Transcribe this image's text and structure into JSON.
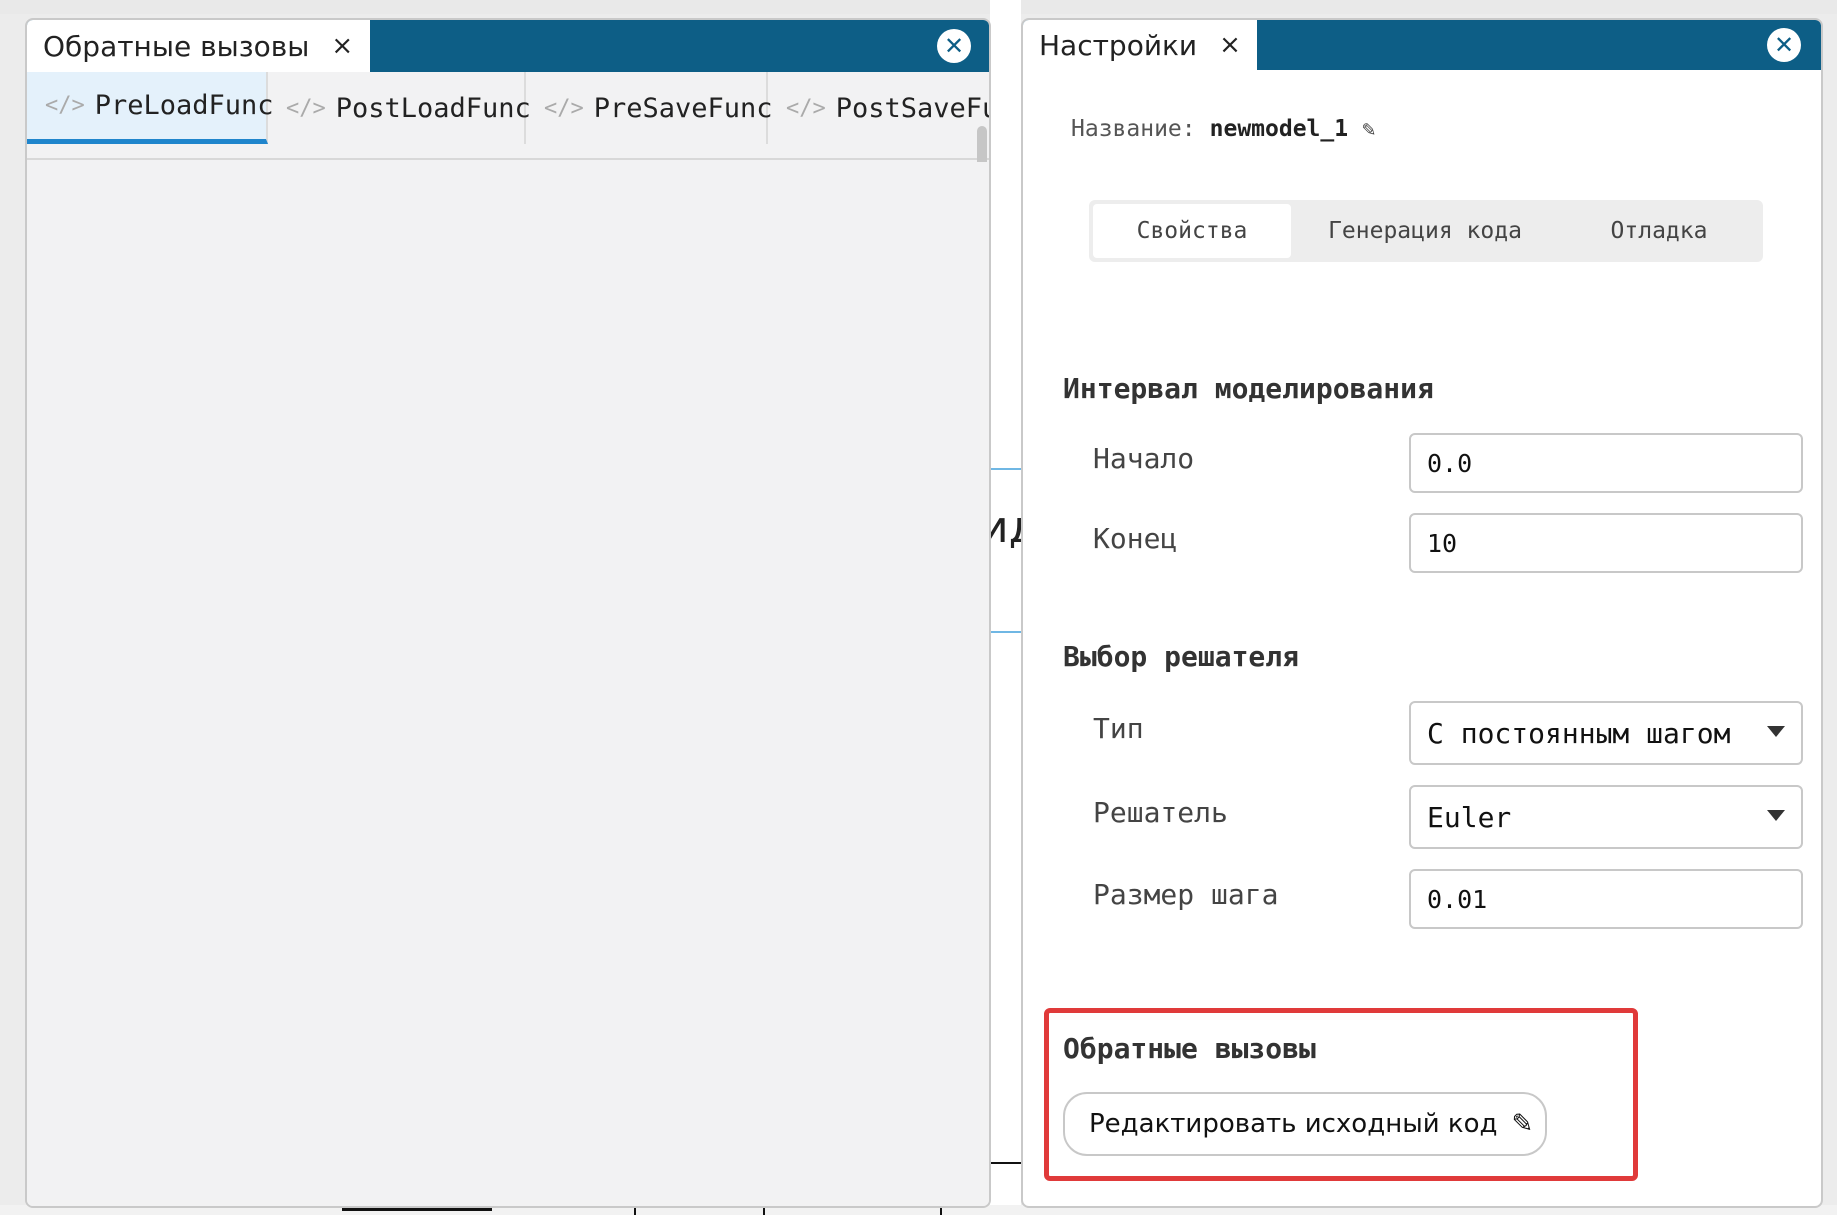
{
  "callbacks_panel": {
    "title": "Обратные вызовы",
    "tab_close": "×",
    "window_close": "✕",
    "tabs": [
      {
        "icon": "</>",
        "label": "PreLoadFunc",
        "active": true
      },
      {
        "icon": "</>",
        "label": "PostLoadFunc",
        "active": false
      },
      {
        "icon": "</>",
        "label": "PreSaveFunc",
        "active": false
      },
      {
        "icon": "</>",
        "label": "PostSaveFu",
        "active": false
      }
    ]
  },
  "background_canvas": {
    "partial_text": "ид"
  },
  "settings_panel": {
    "title": "Настройки",
    "tab_close": "×",
    "window_close": "✕",
    "name_label": "Название:",
    "name_value": "newmodel_1",
    "name_edit_icon": "✎",
    "segments": [
      {
        "label": "Свойства",
        "active": true
      },
      {
        "label": "Генерация кода",
        "active": false
      },
      {
        "label": "Отладка",
        "active": false
      }
    ],
    "interval": {
      "title": "Интервал моделирования",
      "start_label": "Начало",
      "start_value": "0.0",
      "end_label": "Конец",
      "end_value": "10"
    },
    "solver": {
      "title": "Выбор решателя",
      "type_label": "Тип",
      "type_value": "С постоянным шагом",
      "solver_label": "Решатель",
      "solver_value": "Euler",
      "step_label": "Размер шага",
      "step_value": "0.01"
    },
    "callbacks": {
      "title": "Обратные вызовы",
      "edit_button_label": "Редактировать исходный код",
      "edit_icon": "✎"
    }
  },
  "colors": {
    "titlebar": "#0d5e86",
    "active_tab_underline": "#1f85cc",
    "highlight": "#e03a3a"
  }
}
